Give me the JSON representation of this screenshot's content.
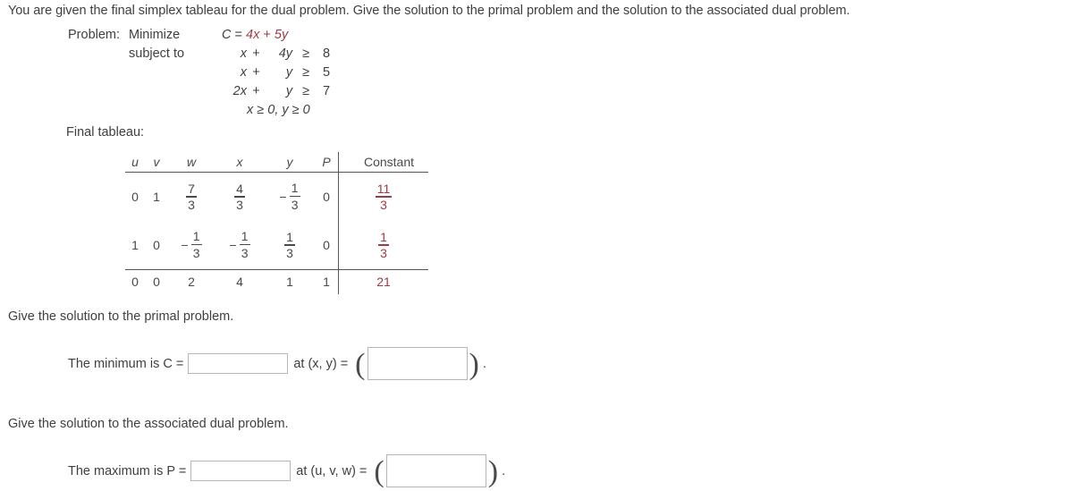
{
  "intro": "You are given the final simplex tableau for the dual problem. Give the solution to the primal problem and the solution to the associated dual problem.",
  "problem": {
    "label": "Problem:",
    "minimize_label": "Minimize",
    "subject_to_label": "subject to",
    "objective": {
      "name": "C",
      "equals": "=",
      "term1": "4x",
      "op": "+",
      "term2": "5y",
      "full": "C = 4x + 5y"
    },
    "constraints": [
      {
        "t1": "x",
        "op": "+",
        "t2": "4y",
        "rel": "≥",
        "rhs": "8"
      },
      {
        "t1": "x",
        "op": "+",
        "t2": "y",
        "rel": "≥",
        "rhs": "5"
      },
      {
        "t1": "2x",
        "op": "+",
        "t2": "y",
        "rel": "≥",
        "rhs": "7"
      }
    ],
    "nonnegativity": "x ≥ 0, y ≥ 0"
  },
  "tableau": {
    "caption": "Final tableau:",
    "headers": [
      "u",
      "v",
      "w",
      "x",
      "y",
      "P",
      "Constant"
    ],
    "accent_color": "#a03a46",
    "rows": [
      {
        "cells": [
          {
            "type": "int",
            "value": "0"
          },
          {
            "type": "int",
            "value": "1"
          },
          {
            "type": "frac",
            "sign": "",
            "num": "7",
            "den": "3"
          },
          {
            "type": "frac",
            "sign": "",
            "num": "4",
            "den": "3"
          },
          {
            "type": "frac",
            "sign": "−",
            "num": "1",
            "den": "3"
          },
          {
            "type": "int",
            "value": "0"
          },
          {
            "type": "frac",
            "sign": "",
            "num": "11",
            "den": "3",
            "accent": true
          }
        ]
      },
      {
        "cells": [
          {
            "type": "int",
            "value": "1"
          },
          {
            "type": "int",
            "value": "0"
          },
          {
            "type": "frac",
            "sign": "−",
            "num": "1",
            "den": "3"
          },
          {
            "type": "frac",
            "sign": "−",
            "num": "1",
            "den": "3"
          },
          {
            "type": "frac",
            "sign": "",
            "num": "1",
            "den": "3"
          },
          {
            "type": "int",
            "value": "0"
          },
          {
            "type": "frac",
            "sign": "",
            "num": "1",
            "den": "3",
            "accent": true
          }
        ]
      }
    ],
    "bottom_row": {
      "cells": [
        {
          "type": "int",
          "value": "0"
        },
        {
          "type": "int",
          "value": "0"
        },
        {
          "type": "int",
          "value": "2"
        },
        {
          "type": "int",
          "value": "4"
        },
        {
          "type": "int",
          "value": "1"
        },
        {
          "type": "int",
          "value": "1"
        },
        {
          "type": "int",
          "value": "21",
          "accent": true
        }
      ]
    }
  },
  "primal": {
    "prompt": "Give the solution to the primal problem.",
    "answer_label": "The minimum is C =",
    "value_placeholder": "",
    "value": "",
    "at_label": "at (x, y) =",
    "point_placeholder": "",
    "point": "",
    "trailing": "."
  },
  "dual": {
    "prompt": "Give the solution to the associated dual problem.",
    "answer_label": "The maximum is P =",
    "value_placeholder": "",
    "value": "",
    "at_label": "at (u, v, w) =",
    "point_placeholder": "",
    "point": "",
    "trailing": "."
  }
}
